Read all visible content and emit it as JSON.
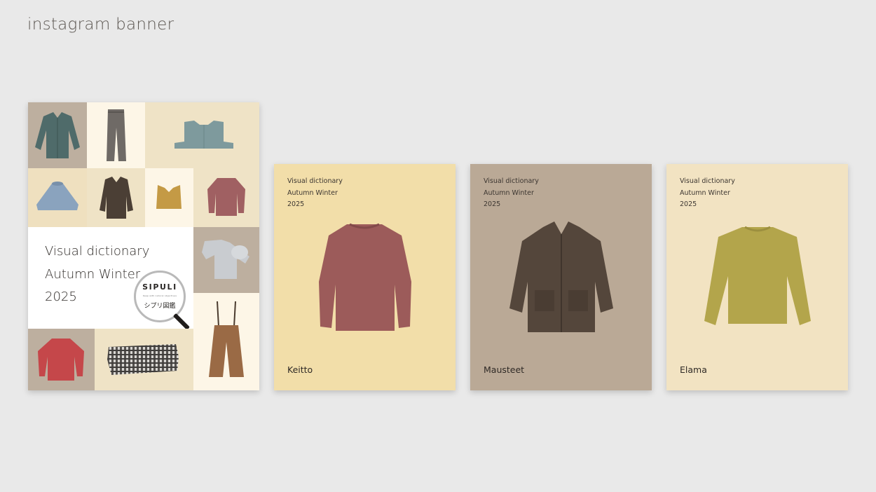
{
  "page": {
    "title": "instagram banner"
  },
  "cover": {
    "lines": [
      "Visual dictionary",
      "Autumn Winter",
      "2025"
    ],
    "brand": "SIPULI",
    "brand_sub": "Keep with natural objectives",
    "brand_jp": "シプリ図鑑"
  },
  "cards": [
    {
      "line1": "Visual dictionary",
      "line2": "Autumn Winter",
      "line3": "2025",
      "name": "Keitto"
    },
    {
      "line1": "Visual dictionary",
      "line2": "Autumn Winter",
      "line3": "2025",
      "name": "Mausteet"
    },
    {
      "line1": "Visual dictionary",
      "line2": "Autumn Winter",
      "line3": "2025",
      "name": "Elama"
    }
  ],
  "colors": {
    "background": "#e9e9e9",
    "keitto_bg": "#f2dea9",
    "mausteet_bg": "#baa996",
    "elama_bg": "#f2e3c2",
    "cover_taupe": "#bdaf9f",
    "cover_cream": "#fdf6e7",
    "cover_sand": "#efe3c6"
  },
  "icons": [
    "magnifier-icon"
  ]
}
